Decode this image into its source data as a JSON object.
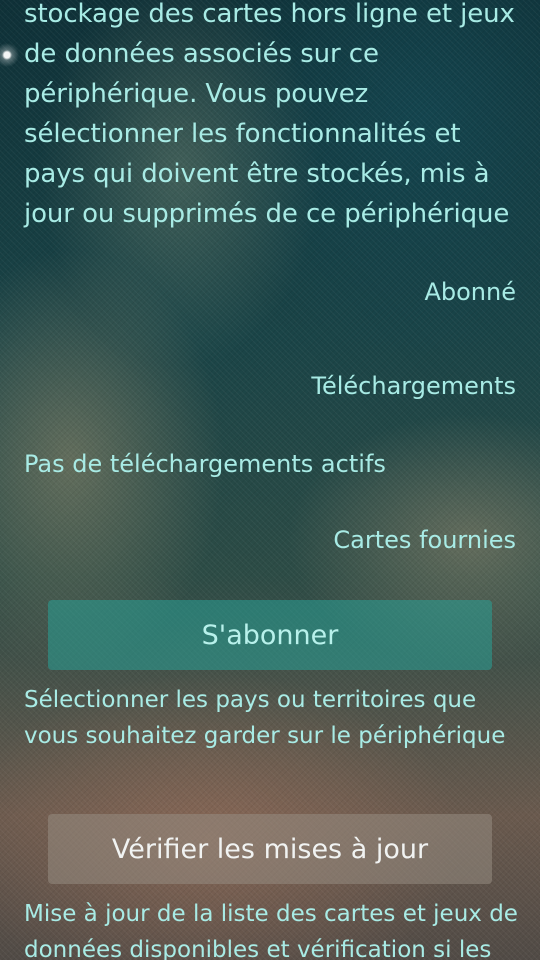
{
  "intro": {
    "text": "stockage des cartes hors ligne et jeux\nde données associés sur ce\npériphérique. Vous pouvez\nsélectionner les fonctionnalités et\npays qui doivent être stockés, mis à\njour ou supprimés de ce périphérique"
  },
  "subscription": {
    "status_label": "Abonné"
  },
  "downloads": {
    "section_label": "Téléchargements",
    "status_text": "Pas de téléchargements actifs"
  },
  "maps": {
    "section_label": "Cartes fournies",
    "subscribe_button": "S'abonner",
    "subscribe_help": "Sélectionner les pays ou territoires que\nvous souhaitez garder sur le périphérique",
    "check_updates_button": "Vérifier les mises à jour",
    "check_updates_help": "Mise à jour de la liste des cartes et jeux de\ndonnées disponibles et vérification si les"
  }
}
